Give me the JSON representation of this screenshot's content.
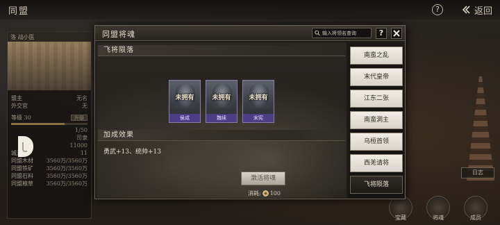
{
  "topbar": {
    "title": "同盟",
    "help_label": "?",
    "back_label": "返回"
  },
  "left_panel": {
    "header": "洛 战小医",
    "rows": [
      {
        "label": "盟主",
        "value": "无名"
      },
      {
        "label": "外交官",
        "value": "无"
      }
    ],
    "level_label": "等级",
    "level_value": "30",
    "level_button": "升级",
    "stats": [
      {
        "label": "",
        "value": "1/50"
      },
      {
        "label": "",
        "value": "司隶"
      },
      {
        "label": "",
        "value": "11000"
      },
      {
        "label": "城池数",
        "value": "11"
      },
      {
        "label": "同盟木材",
        "value": "3560万/3560万"
      },
      {
        "label": "同盟铁矿",
        "value": "3560万/3560万"
      },
      {
        "label": "同盟石料",
        "value": "3560万/3560万"
      },
      {
        "label": "同盟粮草",
        "value": "3560万/3560万"
      }
    ]
  },
  "background": {
    "right_button": "日志",
    "bottom_icons": [
      "宝藏",
      "将魂",
      "成员"
    ]
  },
  "modal": {
    "title": "同盟将魂",
    "search_placeholder": "输入将领名查询",
    "help_label": "?",
    "section_generals": "飞将陨落",
    "generals": [
      {
        "name": "侯成",
        "status": "未拥有"
      },
      {
        "name": "魏续",
        "status": "未拥有"
      },
      {
        "name": "宋宪",
        "status": "未拥有"
      }
    ],
    "section_bonus": "加成效果",
    "bonus_text": "勇武+13、统帅+13",
    "activate_button": "激活将魂",
    "cost_label": "消耗:",
    "cost_value": "100",
    "tabs": [
      {
        "label": "南蛮之乱",
        "active": false
      },
      {
        "label": "末代皇帝",
        "active": false
      },
      {
        "label": "江东二张",
        "active": false
      },
      {
        "label": "南蛮洞主",
        "active": false
      },
      {
        "label": "乌桓首领",
        "active": false
      },
      {
        "label": "西羌请将",
        "active": false
      },
      {
        "label": "飞将陨落",
        "active": true
      }
    ]
  },
  "colors": {
    "card_name_bg": "#4b3d86",
    "active_tab_bg": "#1d1a17",
    "tab_bg": "#f1ede6"
  }
}
